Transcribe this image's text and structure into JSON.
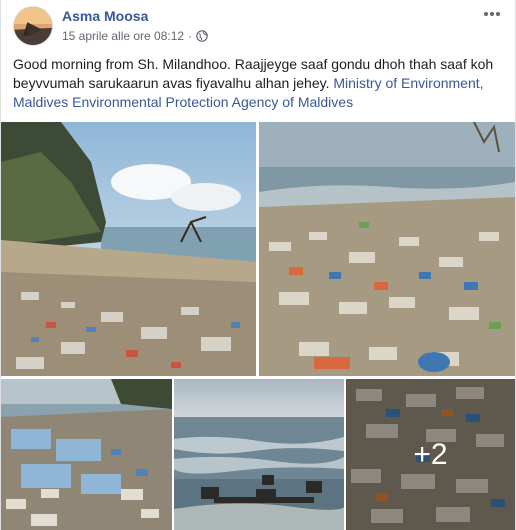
{
  "post": {
    "author": "Asma Moosa",
    "timestamp": "15 aprile alle ore 08:12",
    "separator": "·",
    "privacy_icon": "globe-icon",
    "more_icon": "more-options-icon",
    "text_main": "Good morning from Sh. Milandhoo. Raajjeyge saaf gondu dhoh thah saaf koh beyvvumah sarukaarun avas fiyavalhu alhan jehey. ",
    "mention_1": "Ministry of Environment, Maldives",
    "mention_sep": " ",
    "mention_2": "Environmental Protection Agency of Maldives"
  },
  "photos": {
    "count": 5,
    "more_overlay": "+2"
  },
  "colors": {
    "link": "#385898",
    "text": "#1c1e21",
    "meta": "#616770"
  }
}
